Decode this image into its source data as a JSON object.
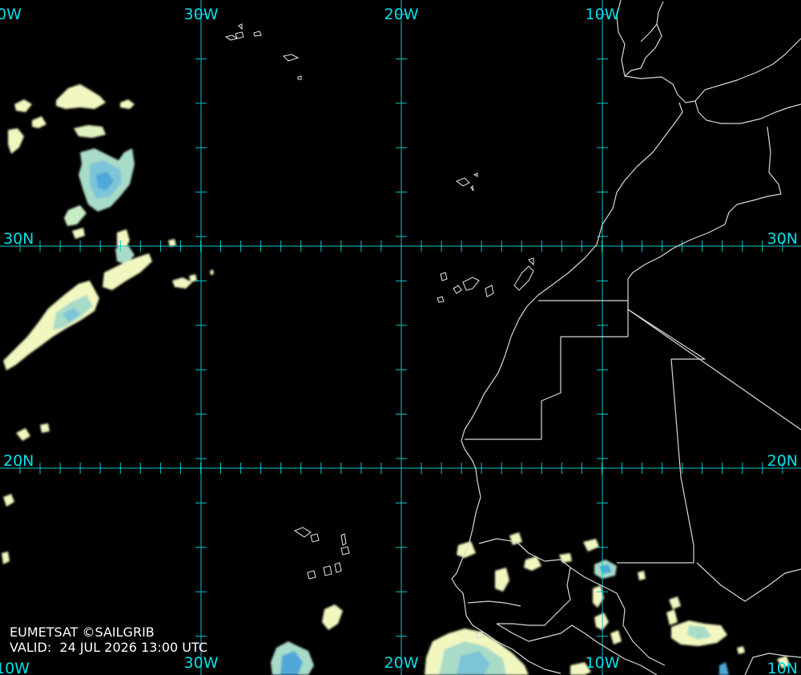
{
  "map": {
    "credit": "EUMETSAT ©SAILGRIB",
    "valid_label": "VALID:",
    "valid_time": "24 JUL 2026 13:00 UTC",
    "labels": {
      "lon_top": [
        "0W",
        "30W",
        "20W",
        "10W"
      ],
      "lon_bottom": [
        "10W",
        "30W",
        "20W",
        "10W"
      ],
      "lat_left": [
        "30N",
        "20N"
      ],
      "lat_right": [
        "30N",
        "20N",
        "10N"
      ]
    },
    "colors": {
      "background": "#000000",
      "grid": "#00c8d2",
      "grid_label": "#00e0e8",
      "coastline": "#d8d8d8",
      "cloud_light": "#f2f7c0",
      "cloud_mid": "#a8dcc8",
      "cloud_dense": "#4fa8d8"
    }
  }
}
